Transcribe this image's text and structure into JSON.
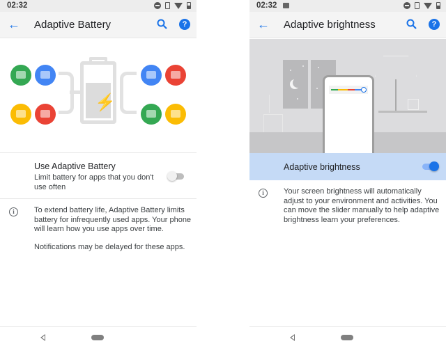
{
  "left_screen": {
    "status_bar": {
      "time": "02:32",
      "icons": [
        "dnd-icon",
        "vibrate-icon",
        "wifi-icon",
        "battery-icon"
      ]
    },
    "toolbar": {
      "title": "Adaptive Battery",
      "back_icon": "arrow-back-icon",
      "search_icon": "search-icon",
      "help_icon": "help-icon",
      "help_glyph": "?"
    },
    "illustration": {
      "left_apps": [
        {
          "name": "messages-icon",
          "color": "#34a853"
        },
        {
          "name": "email-icon",
          "color": "#4285f4"
        },
        {
          "name": "work-icon",
          "color": "#fbbc04"
        },
        {
          "name": "fitness-icon",
          "color": "#ea4335"
        }
      ],
      "right_apps": [
        {
          "name": "calendar-icon",
          "color": "#4285f4"
        },
        {
          "name": "video-icon",
          "color": "#ea4335"
        },
        {
          "name": "maps-icon",
          "color": "#34a853"
        },
        {
          "name": "ticket-icon",
          "color": "#fbbc04"
        }
      ],
      "bolt_glyph": "⚡"
    },
    "preference": {
      "title": "Use Adaptive Battery",
      "summary": "Limit battery for apps that you don't use often",
      "enabled": false
    },
    "info": {
      "glyph": "i",
      "paragraph1": "To extend battery life, Adaptive Battery limits battery for infrequently used apps. Your phone will learn how you use apps over time.",
      "paragraph2": "Notifications may be delayed for these apps."
    }
  },
  "right_screen": {
    "status_bar": {
      "time": "02:32",
      "icons": [
        "image-notification-icon",
        "dnd-icon",
        "vibrate-icon",
        "wifi-icon",
        "battery-icon"
      ]
    },
    "toolbar": {
      "title": "Adaptive brightness",
      "back_icon": "arrow-back-icon",
      "search_icon": "search-icon",
      "help_icon": "help-icon",
      "help_glyph": "?"
    },
    "preference": {
      "title": "Adaptive brightness",
      "enabled": true
    },
    "info": {
      "glyph": "i",
      "text": "Your screen brightness will automatically adjust to your environment and activities. You can move the slider manually to help adaptive brightness learn your preferences."
    },
    "brightness_level": 0.95
  },
  "nav": {
    "back_icon": "nav-back-icon",
    "home_icon": "nav-home-pill"
  },
  "colors": {
    "accent": "#1a73e8",
    "highlight": "#c5daf6"
  }
}
